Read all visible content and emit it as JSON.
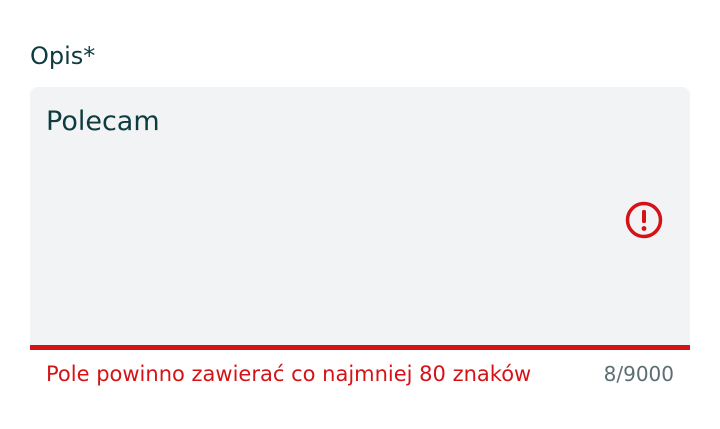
{
  "field": {
    "label": "Opis*",
    "value": "Polecam",
    "status_icon": "error-exclamation-icon",
    "error_message": "Pole powinno zawierać co najmniej 80 znaków",
    "counter": "8/9000"
  },
  "colors": {
    "label_text": "#0d3b3e",
    "input_background": "#f2f3f4",
    "error": "#d51317",
    "counter_text": "#5a6f72"
  }
}
